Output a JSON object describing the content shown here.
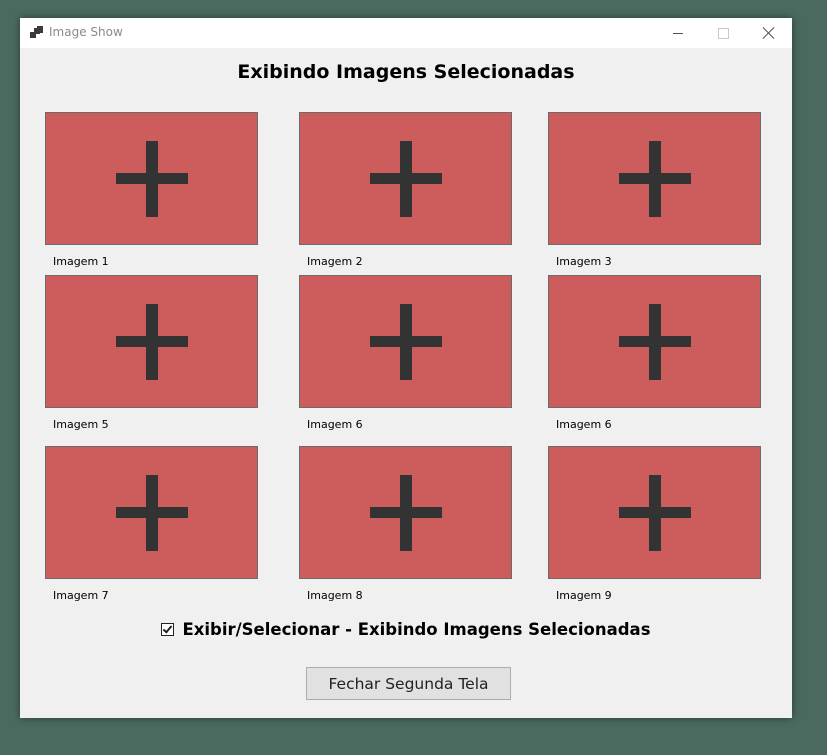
{
  "window": {
    "title": "Image Show",
    "icon": "app-window-icon",
    "controls": [
      "minimize-icon",
      "maximize-icon",
      "close-icon"
    ]
  },
  "heading": "Exibindo Imagens Selecionadas",
  "images": [
    {
      "label": "Imagem 1",
      "icon": "plus-icon"
    },
    {
      "label": "Imagem 2",
      "icon": "plus-icon"
    },
    {
      "label": "Imagem 3",
      "icon": "plus-icon"
    },
    {
      "label": "Imagem 5",
      "icon": "plus-icon"
    },
    {
      "label": "Imagem 6",
      "icon": "plus-icon"
    },
    {
      "label": "Imagem 6",
      "icon": "plus-icon"
    },
    {
      "label": "Imagem 7",
      "icon": "plus-icon"
    },
    {
      "label": "Imagem 8",
      "icon": "plus-icon"
    },
    {
      "label": "Imagem 9",
      "icon": "plus-icon"
    }
  ],
  "checkbox": {
    "checked": true,
    "label": "Exibir/Selecionar - Exibindo Imagens Selecionadas"
  },
  "close_button": "Fechar Segunda Tela",
  "colors": {
    "image_background": "#cd5c5c",
    "plus": "#333333",
    "window_background": "#f0f0f0",
    "desktop": "#4a6a60"
  }
}
